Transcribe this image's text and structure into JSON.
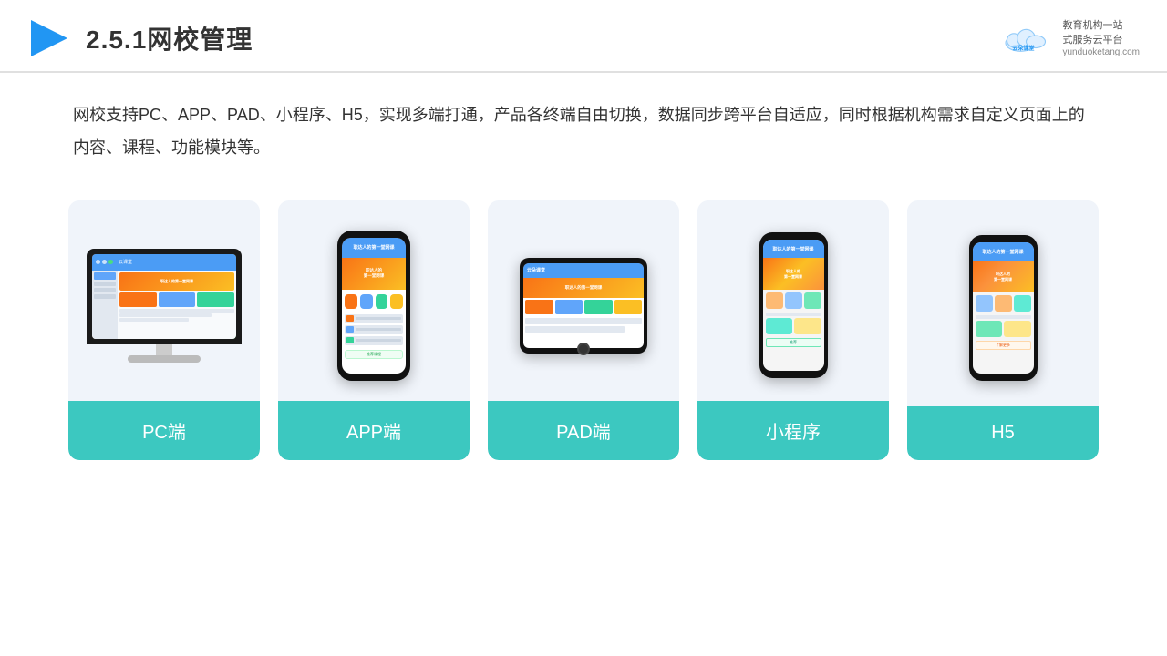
{
  "header": {
    "title": "2.5.1网校管理",
    "logo_name": "云朵课堂",
    "logo_url": "yunduoketang.com",
    "logo_slogan": "教育机构一站\n式服务云平台"
  },
  "description": {
    "text": "网校支持PC、APP、PAD、小程序、H5，实现多端打通，产品各终端自由切换，数据同步跨平台自适应，同时根据机构需求自定义页面上的内容、课程、功能模块等。"
  },
  "cards": [
    {
      "id": "pc",
      "label": "PC端"
    },
    {
      "id": "app",
      "label": "APP端"
    },
    {
      "id": "pad",
      "label": "PAD端"
    },
    {
      "id": "mini",
      "label": "小程序"
    },
    {
      "id": "h5",
      "label": "H5"
    }
  ]
}
